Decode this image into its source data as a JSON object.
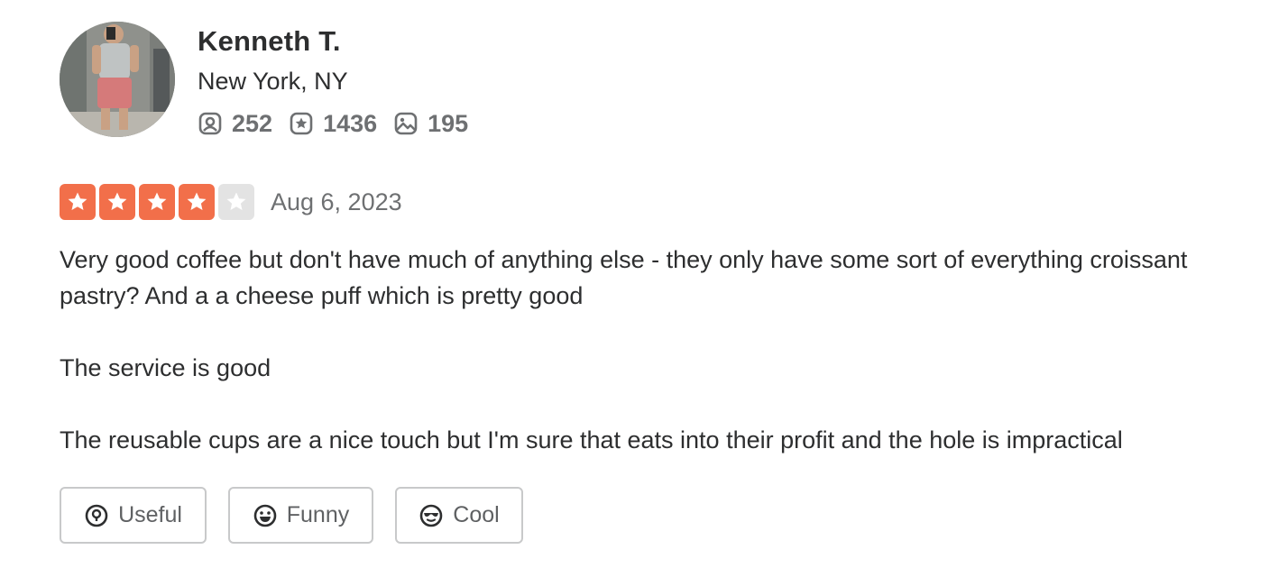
{
  "user": {
    "name": "Kenneth T.",
    "location": "New York, NY",
    "stats": {
      "friends": "252",
      "reviews": "1436",
      "photos": "195"
    }
  },
  "review": {
    "rating": 4,
    "max_rating": 5,
    "date": "Aug 6, 2023",
    "paragraphs": [
      "Very good coffee but don't have much of anything else - they only have some sort of everything croissant pastry? And a a cheese puff which is pretty good",
      "The service is good",
      "The reusable cups are a nice touch but I'm sure that eats into their profit and the hole is impractical"
    ]
  },
  "reactions": {
    "useful_label": "Useful",
    "funny_label": "Funny",
    "cool_label": "Cool"
  },
  "colors": {
    "star_active": "#f26f4a",
    "star_inactive": "#e3e3e3",
    "text_primary": "#2d2e2f",
    "text_secondary": "#6e7072",
    "button_border": "#c8c9ca"
  }
}
